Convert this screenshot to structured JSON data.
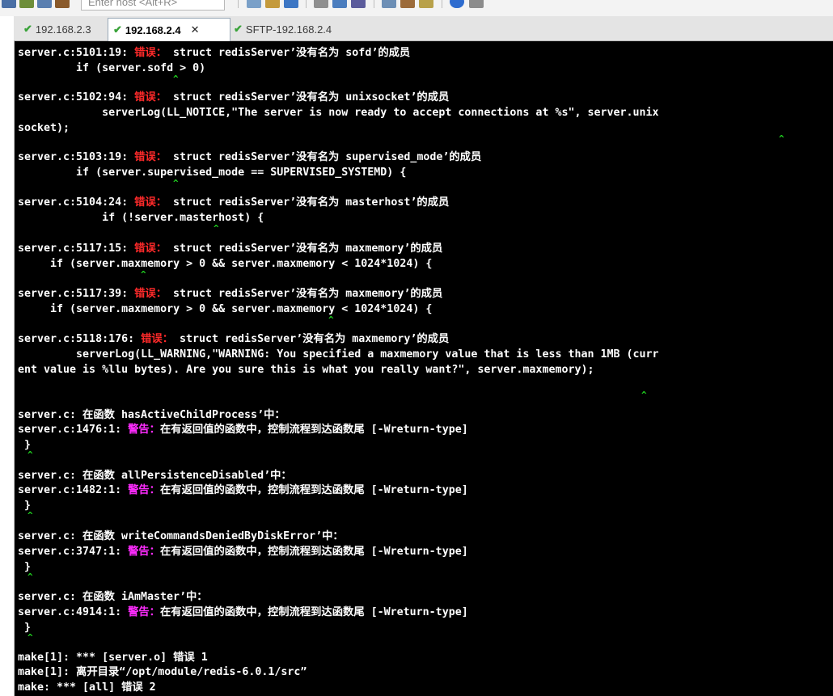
{
  "toolbar": {
    "host_placeholder": "Enter host <Alt+R>"
  },
  "tabs": [
    {
      "label": "192.168.2.3"
    },
    {
      "label": "192.168.2.4"
    },
    {
      "label": "SFTP-192.168.2.4"
    }
  ],
  "colors": {
    "error": "#ff2a2a",
    "warning": "#ff2cff",
    "text": "#ffffff",
    "caret": "#1fd11f",
    "background": "#000000"
  },
  "terminal": {
    "lines": [
      {
        "text": "server.c:5101:19: ",
        "tag": "错误：",
        "msg": " struct redisServer’没有名为 sofd’的成员"
      },
      {
        "text": "         if (server.sofd > 0)"
      },
      {
        "text": "server.c:5102:94: ",
        "tag": "错误：",
        "msg": " struct redisServer’没有名为 unixsocket’的成员"
      },
      {
        "text": "             serverLog(LL_NOTICE,\"The server is now ready to accept connections at %s\", server.unix"
      },
      {
        "text": "socket);"
      },
      {
        "text": "server.c:5103:19: ",
        "tag": "错误：",
        "msg": " struct redisServer’没有名为 supervised_mode’的成员"
      },
      {
        "text": "         if (server.supervised_mode == SUPERVISED_SYSTEMD) {"
      },
      {
        "text": "server.c:5104:24: ",
        "tag": "错误：",
        "msg": " struct redisServer’没有名为 masterhost’的成员"
      },
      {
        "text": "             if (!server.masterhost) {"
      },
      {
        "text": "server.c:5117:15: ",
        "tag": "错误：",
        "msg": " struct redisServer’没有名为 maxmemory’的成员"
      },
      {
        "text": "     if (server.maxmemory > 0 && server.maxmemory < 1024*1024) {"
      },
      {
        "text": "server.c:5117:39: ",
        "tag": "错误：",
        "msg": " struct redisServer’没有名为 maxmemory’的成员"
      },
      {
        "text": "     if (server.maxmemory > 0 && server.maxmemory < 1024*1024) {"
      },
      {
        "text": "server.c:5118:176: ",
        "tag": "错误：",
        "msg": " struct redisServer’没有名为 maxmemory’的成员"
      },
      {
        "text": "         serverLog(LL_WARNING,\"WARNING: You specified a maxmemory value that is less than 1MB (curr"
      },
      {
        "text": "ent value is %llu bytes). Are you sure this is what you really want?\", server.maxmemory);"
      },
      {
        "text": "server.c: 在函数 hasActiveChildProcess’中："
      },
      {
        "text": "server.c:1476:1: ",
        "tag": "警告：",
        "msg": "在有返回值的函数中，控制流程到达函数尾 [-Wreturn-type]"
      },
      {
        "text": " }"
      },
      {
        "text": "server.c: 在函数 allPersistenceDisabled’中："
      },
      {
        "text": "server.c:1482:1: ",
        "tag": "警告：",
        "msg": "在有返回值的函数中，控制流程到达函数尾 [-Wreturn-type]"
      },
      {
        "text": " }"
      },
      {
        "text": "server.c: 在函数 writeCommandsDeniedByDiskError’中："
      },
      {
        "text": "server.c:3747:1: ",
        "tag": "警告：",
        "msg": "在有返回值的函数中，控制流程到达函数尾 [-Wreturn-type]"
      },
      {
        "text": " }"
      },
      {
        "text": "server.c: 在函数 iAmMaster’中："
      },
      {
        "text": "server.c:4914:1: ",
        "tag": "警告：",
        "msg": "在有返回值的函数中，控制流程到达函数尾 [-Wreturn-type]"
      },
      {
        "text": " }"
      },
      {
        "text": "make[1]: *** [server.o] 错误 1"
      },
      {
        "text": "make[1]: 离开目录“/opt/module/redis-6.0.1/src”"
      },
      {
        "text": "make: *** [all] 错误 2"
      }
    ]
  }
}
